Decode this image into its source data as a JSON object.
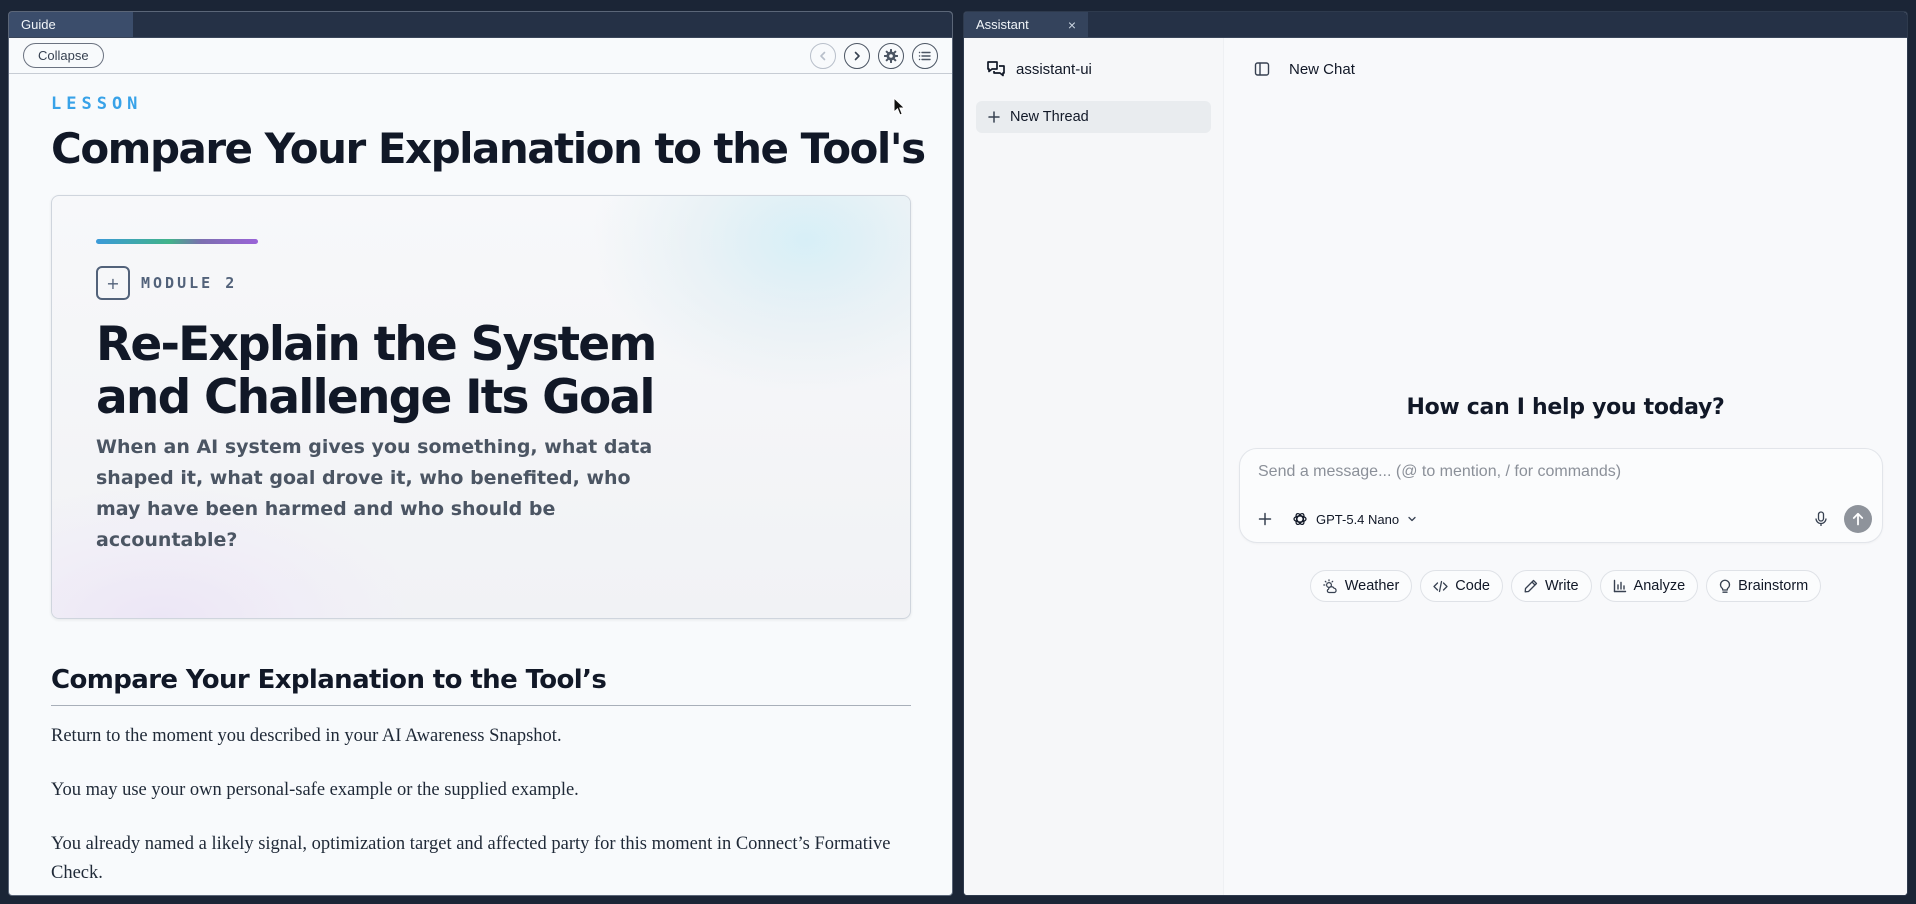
{
  "guide": {
    "tab_label": "Guide",
    "collapse_label": "Collapse",
    "eyebrow": "LESSON",
    "lesson_title": "Compare Your Explanation to the Tool's",
    "hero": {
      "module_icon": "+",
      "module_label": "MODULE 2",
      "title": "Re-Explain the System and Challenge Its Goal",
      "subtitle": "When an AI system gives you something, what data shaped it, what goal drove it, who benefited, who may have been harmed and who should be accountable?"
    },
    "section_heading": "Compare Your Explanation to the Tool’s",
    "paragraphs": [
      "Return to the moment you described in your AI Awareness Snapshot.",
      "You may use your own personal-safe example or the supplied example.",
      "You already named a likely signal, optimization target and affected party for this moment in Connect’s Formative Check."
    ]
  },
  "assistant": {
    "tab_label": "Assistant",
    "close_glyph": "×",
    "brand": "assistant-ui",
    "new_thread_label": "New Thread",
    "header_title": "New Chat",
    "welcome": "How can I help you today?",
    "composer_placeholder": "Send a message... (@ to mention, / for commands)",
    "model_name": "GPT-5.4 Nano",
    "suggestions": [
      {
        "label": "Weather",
        "icon": "weather-icon"
      },
      {
        "label": "Code",
        "icon": "code-icon"
      },
      {
        "label": "Write",
        "icon": "pen-icon"
      },
      {
        "label": "Analyze",
        "icon": "bar-chart-icon"
      },
      {
        "label": "Brainstorm",
        "icon": "lightbulb-icon"
      }
    ]
  }
}
